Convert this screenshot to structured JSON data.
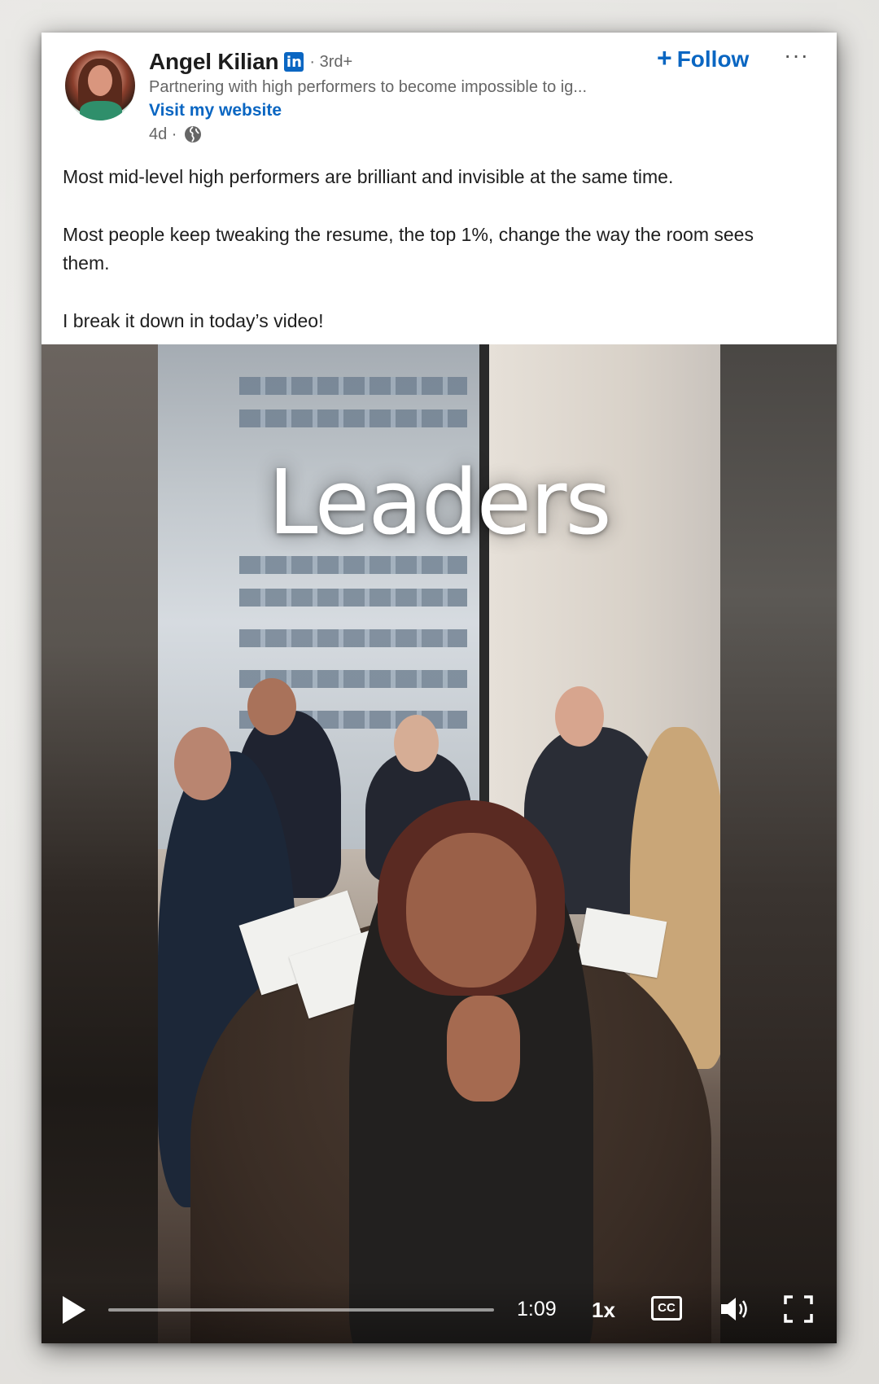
{
  "post": {
    "author": {
      "name": "Angel Kilian",
      "network_badge": "in",
      "degree": "· 3rd+",
      "headline": "Partnering with high performers to become impossible to ig...",
      "website_link": "Visit my website",
      "age": "4d ·"
    },
    "actions": {
      "follow_label": "Follow",
      "follow_icon": "+",
      "more_label": "···"
    },
    "text": {
      "p1": "Most mid-level high performers are brilliant and invisible at the same time.",
      "p2": "Most people keep tweaking the resume, the top 1%, change the way the room sees them.",
      "p3": "I break it down in today’s video!"
    }
  },
  "video": {
    "overlay_text": "Leaders",
    "controls": {
      "time": "1:09",
      "speed": "1x",
      "cc_label": "CC",
      "progress_fraction": 0.0
    }
  },
  "colors": {
    "brand_blue": "#0a66c2",
    "text_primary": "#1e1e1e",
    "text_secondary": "#666666"
  },
  "icons": [
    "linkedin-icon",
    "globe-icon",
    "play-icon",
    "closed-captions-icon",
    "volume-icon",
    "fullscreen-icon",
    "more-icon"
  ]
}
